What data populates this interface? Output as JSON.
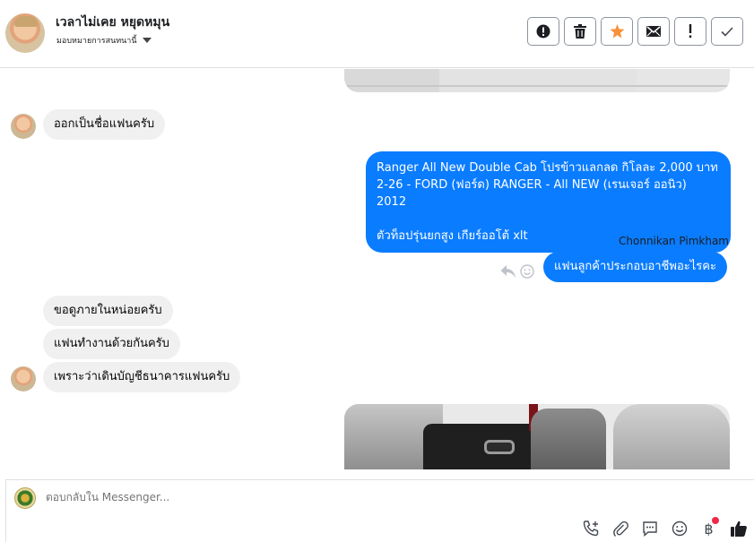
{
  "header": {
    "name": "เวลาไม่เคย หยุดหมุน",
    "assign_label": "มอบหมายการสนทนานี้",
    "actions": [
      {
        "name": "mark-spam-button",
        "icon": "exclamation-circle-icon"
      },
      {
        "name": "delete-button",
        "icon": "trash-icon"
      },
      {
        "name": "star-button",
        "icon": "star-icon"
      },
      {
        "name": "mark-unread-button",
        "icon": "envelope-icon"
      },
      {
        "name": "follow-up-button",
        "icon": "exclamation-icon"
      },
      {
        "name": "done-button",
        "icon": "check-icon"
      }
    ]
  },
  "messages": {
    "m1": "ออกเป็นชื่อแฟนครับ",
    "m2": "Ranger All New Double Cab โปรข้าวแลกลด กิโลละ 2,000 บาท\n2-26 - FORD (ฟอร์ด) RANGER - All NEW (เรนเจอร์ ออนิว) 2012\n\nตัวท็อปรุ่นยกสูง เกียร์ออโต้ xlt",
    "sender": "Chonnikan Pimkham",
    "m3": "แฟนลูกค้าประกอบอาชีพอะไรคะ",
    "m4": "ขอดูภายในหน่อยครับ",
    "m5": "แฟนทำงานด้วยกันครับ",
    "m6": "เพราะว่าเดินบัญชีธนาคารแฟนครับ"
  },
  "composer": {
    "placeholder": "ตอบกลับใน Messenger...",
    "tools": [
      "call-icon",
      "paperclip-icon",
      "saved-reply-icon",
      "emoji-icon",
      "baht-icon",
      "thumbs-up-icon"
    ],
    "baht_symbol": "฿"
  },
  "colors": {
    "outgoing_bubble": "#0a7cff",
    "incoming_bubble": "#f0f0f0",
    "star": "#f7923b",
    "notification_dot": "#f02849"
  }
}
